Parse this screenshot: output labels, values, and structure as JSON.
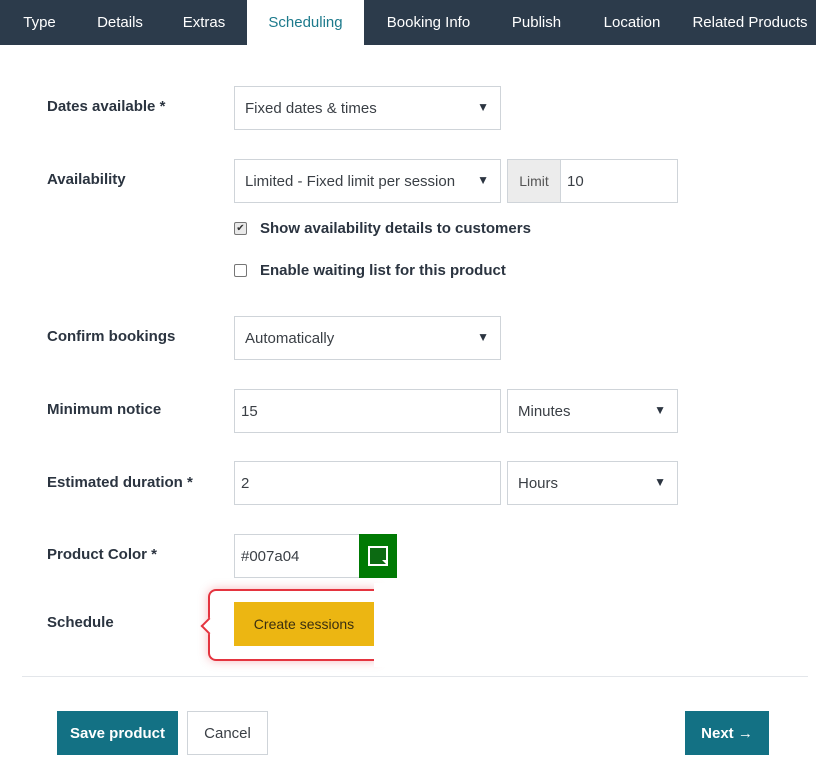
{
  "tabs": [
    {
      "label": "Type"
    },
    {
      "label": "Details"
    },
    {
      "label": "Extras"
    },
    {
      "label": "Scheduling",
      "active": true
    },
    {
      "label": "Booking Info"
    },
    {
      "label": "Publish"
    },
    {
      "label": "Location"
    },
    {
      "label": "Related Products"
    }
  ],
  "form": {
    "dates_available": {
      "label": "Dates available *",
      "value": "Fixed dates & times"
    },
    "availability": {
      "label": "Availability",
      "value": "Limited - Fixed limit per session",
      "limit_addon": "Limit",
      "limit_value": "10",
      "show_details": {
        "label": "Show availability details to customers",
        "checked": true
      },
      "waiting_list": {
        "label": "Enable waiting list for this product",
        "checked": false
      }
    },
    "confirm_bookings": {
      "label": "Confirm bookings",
      "value": "Automatically"
    },
    "minimum_notice": {
      "label": "Minimum notice",
      "value": "15",
      "unit": "Minutes"
    },
    "estimated_duration": {
      "label": "Estimated duration *",
      "value": "2",
      "unit": "Hours"
    },
    "product_color": {
      "label": "Product Color *",
      "value": "#007a04"
    },
    "schedule": {
      "label": "Schedule",
      "button": "Create sessions"
    }
  },
  "footer": {
    "save": "Save product",
    "cancel": "Cancel",
    "next": "Next →"
  },
  "icons": {
    "caret": "▼",
    "check": "✔"
  },
  "colors": {
    "tabbar": "#2c3b4b",
    "active_tab_text": "#1d7a8c",
    "primary": "#137184",
    "highlight_button": "#ecb612",
    "callout_border": "#e4343f",
    "product_color": "#007a04"
  }
}
